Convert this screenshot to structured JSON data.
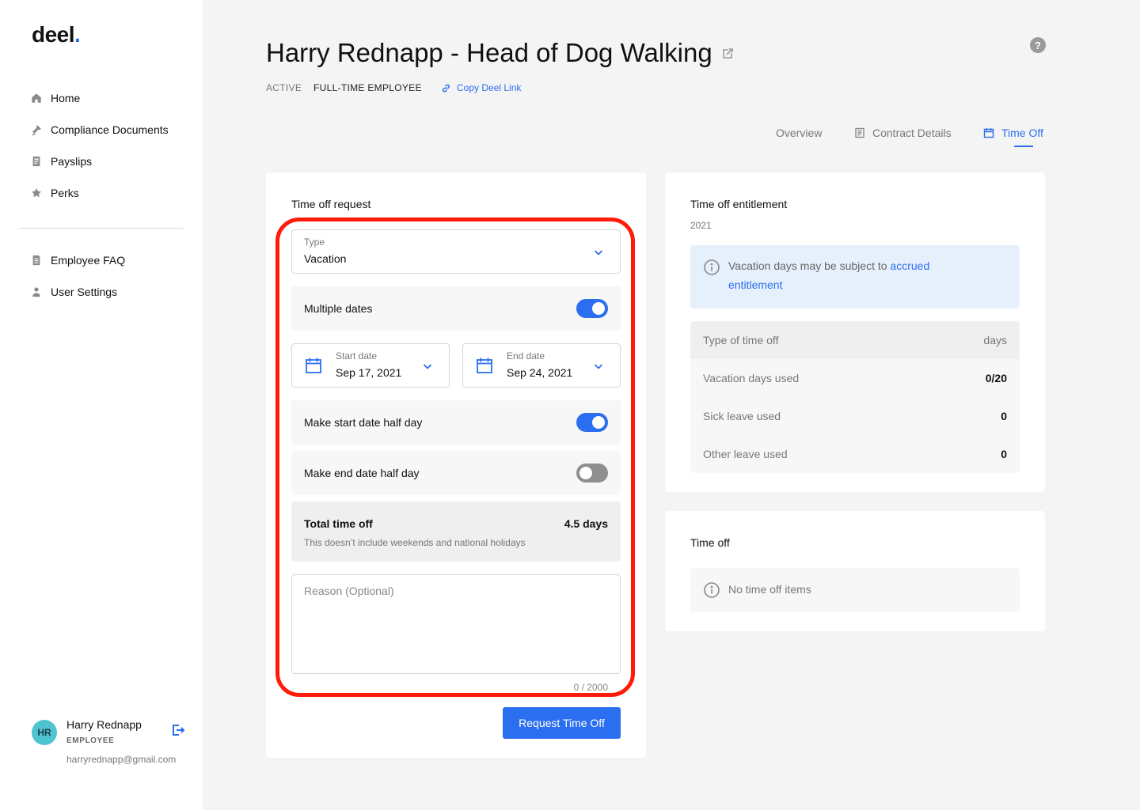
{
  "brand": {
    "name": "deel",
    "dot": "."
  },
  "sidebar": {
    "items": [
      {
        "label": "Home",
        "icon": "home-icon"
      },
      {
        "label": "Compliance Documents",
        "icon": "gavel-icon"
      },
      {
        "label": "Payslips",
        "icon": "document-icon"
      },
      {
        "label": "Perks",
        "icon": "star-icon"
      }
    ],
    "items2": [
      {
        "label": "Employee FAQ",
        "icon": "faq-icon"
      },
      {
        "label": "User Settings",
        "icon": "user-icon"
      }
    ]
  },
  "user": {
    "initials": "HR",
    "name": "Harry Rednapp",
    "role": "EMPLOYEE",
    "email": "harryrednapp@gmail.com"
  },
  "header": {
    "title": "Harry Rednapp - Head of Dog Walking",
    "status": "ACTIVE",
    "employment_type": "FULL-TIME EMPLOYEE",
    "copy_link": "Copy Deel Link",
    "help": "?"
  },
  "tabs": [
    {
      "label": "Overview"
    },
    {
      "label": "Contract Details"
    },
    {
      "label": "Time Off",
      "active": true
    }
  ],
  "request": {
    "title": "Time off request",
    "type_label": "Type",
    "type_value": "Vacation",
    "multiple_dates_label": "Multiple dates",
    "multiple_dates": true,
    "start_label": "Start date",
    "start_value": "Sep 17, 2021",
    "end_label": "End date",
    "end_value": "Sep 24, 2021",
    "start_half_label": "Make start date half day",
    "start_half": true,
    "end_half_label": "Make end date half day",
    "end_half": false,
    "total_label": "Total time off",
    "total_value": "4.5 days",
    "total_note": "This doesn’t include weekends and national holidays",
    "reason_placeholder": "Reason (Optional)",
    "reason_value": "",
    "counter": "0 / 2000",
    "submit_label": "Request Time Off"
  },
  "entitlement": {
    "title": "Time off entitlement",
    "year": "2021",
    "info_text": "Vacation days may be subject to ",
    "info_link": "accrued entitlement",
    "head_type": "Type of time off",
    "head_days": "days",
    "rows": [
      {
        "label": "Vacation days used",
        "value": "0/20"
      },
      {
        "label": "Sick leave used",
        "value": "0"
      },
      {
        "label": "Other leave used",
        "value": "0"
      }
    ]
  },
  "time_off": {
    "title": "Time off",
    "empty_text": "No time off items"
  },
  "colors": {
    "accent": "#2b6ff0",
    "highlight": "#ff1a0a",
    "avatar": "#4fc3d0"
  }
}
